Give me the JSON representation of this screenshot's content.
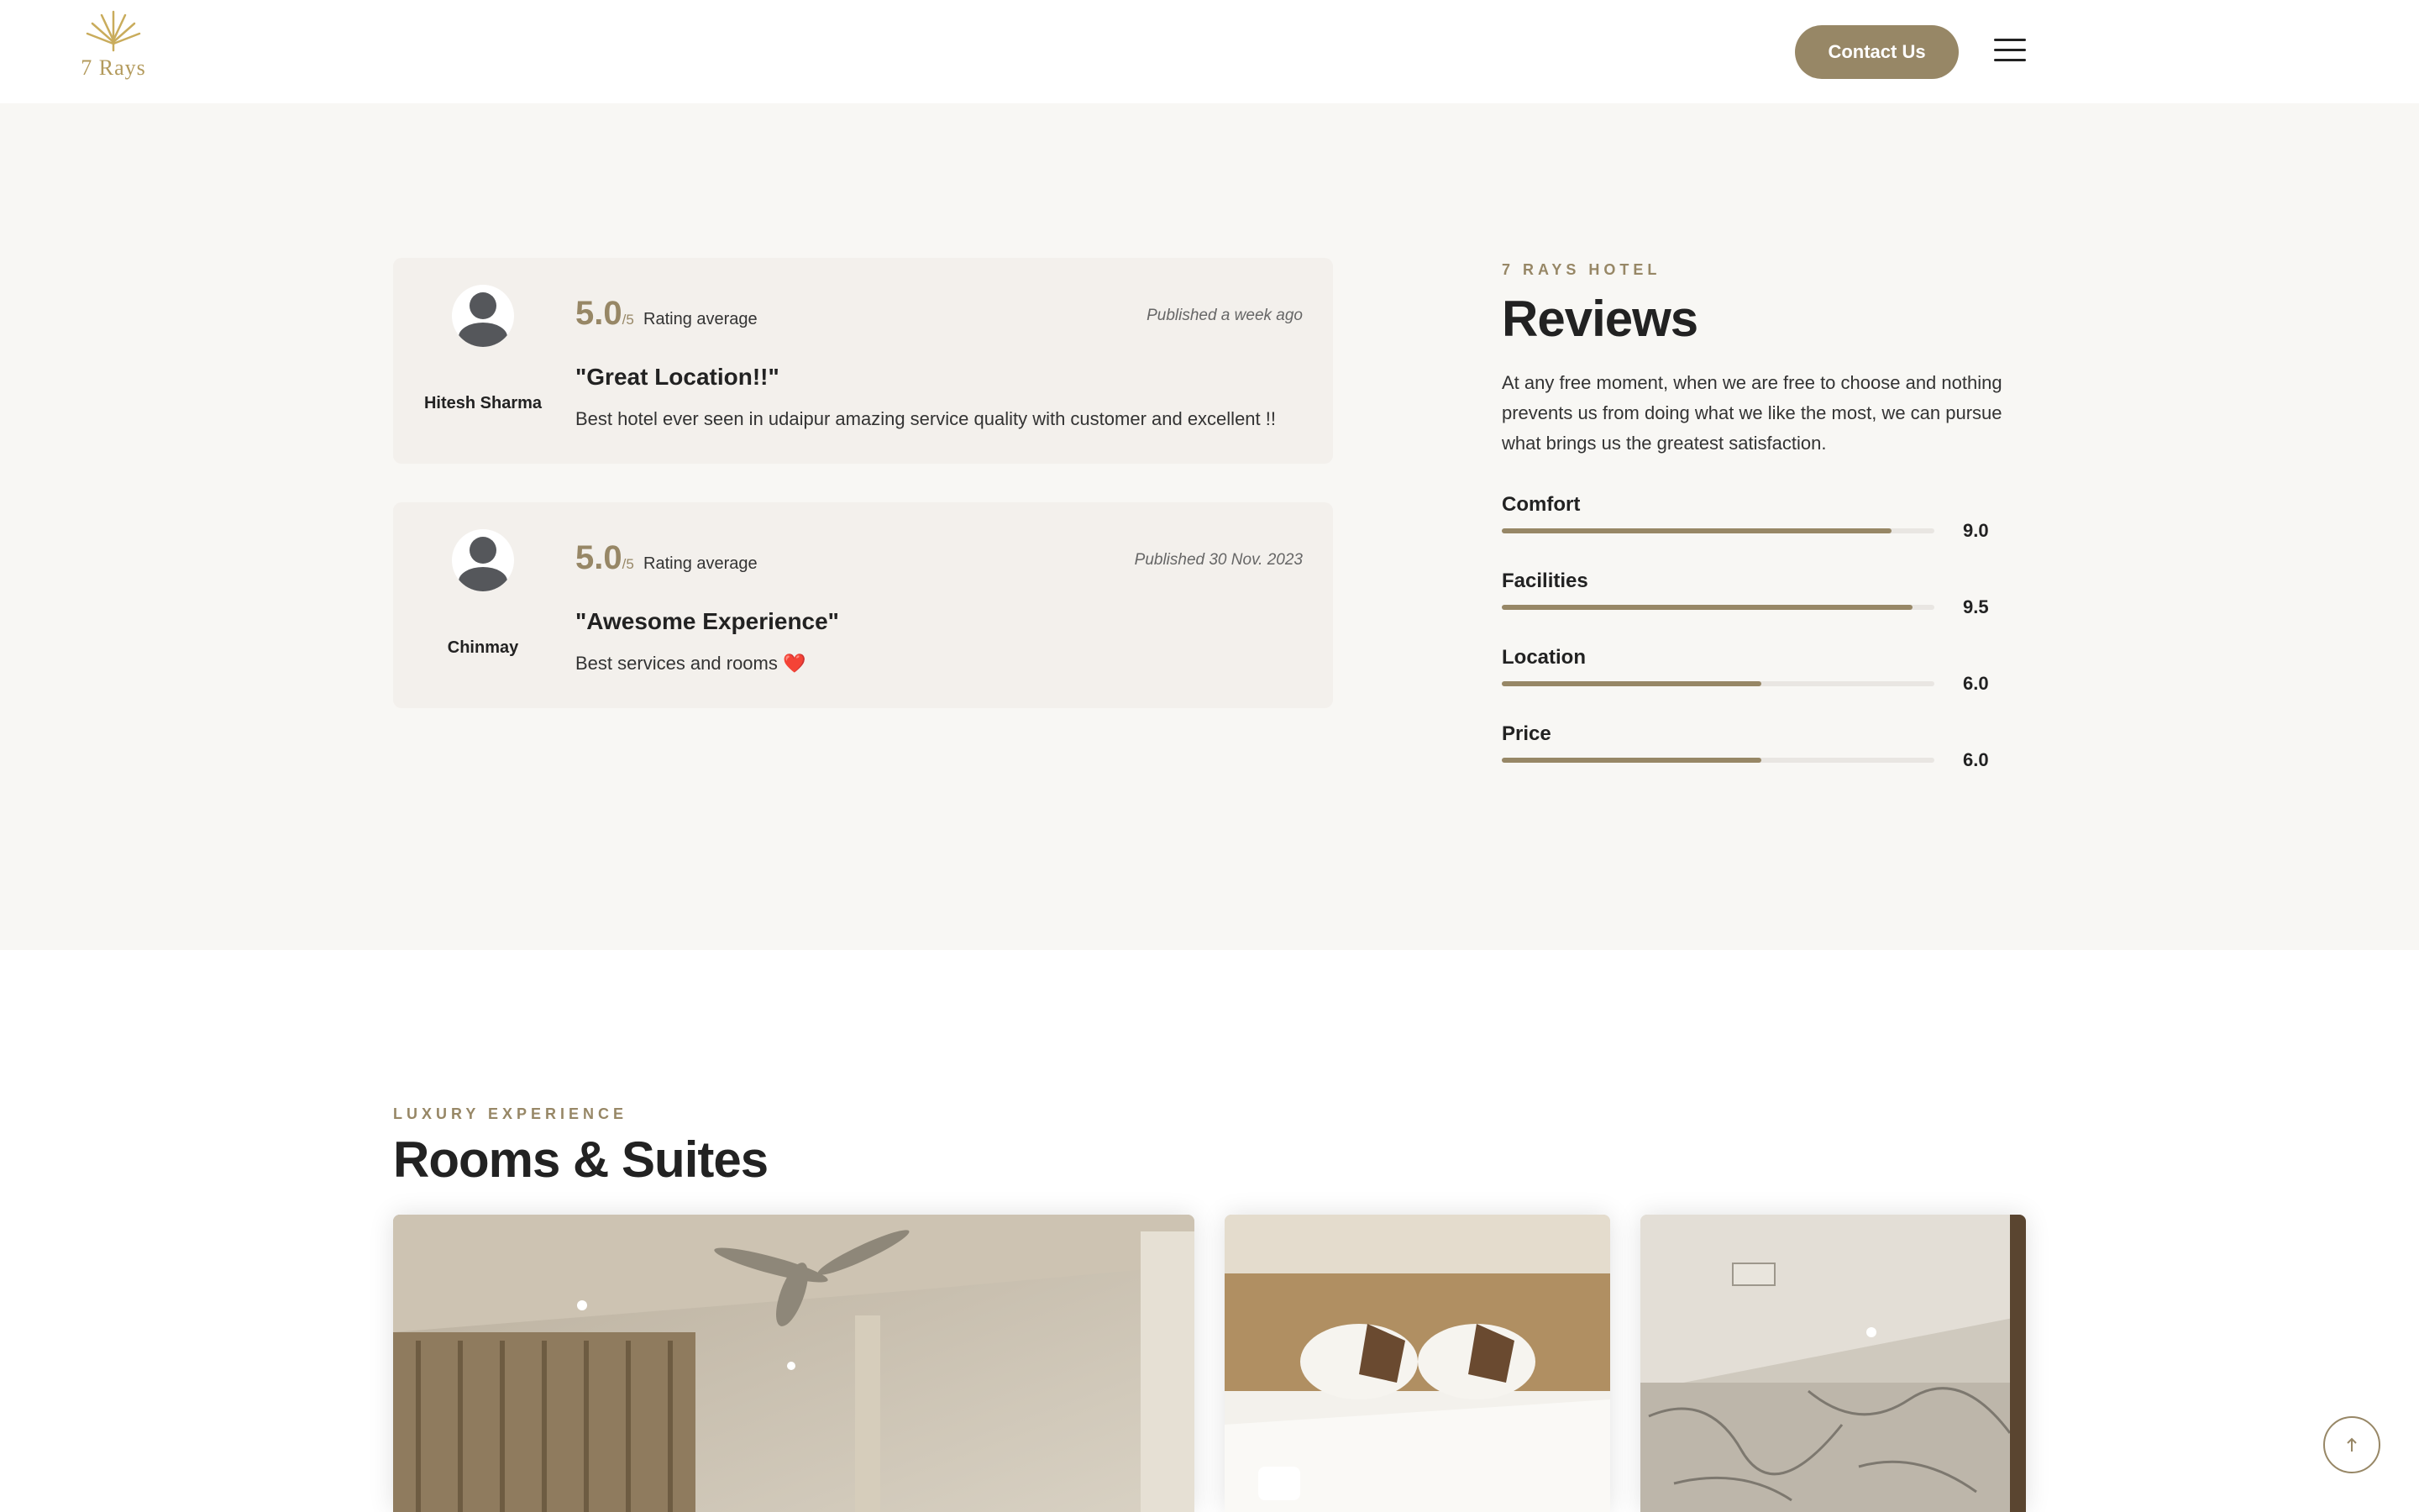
{
  "header": {
    "logo_text": "7 Rays",
    "contact_label": "Contact Us"
  },
  "reviews": [
    {
      "name": "Hitesh Sharma",
      "rating": "5.0",
      "rating_max": "/5",
      "rating_label": "Rating average",
      "published": "Published a week ago",
      "title": "\"Great Location!!\"",
      "body": "Best hotel ever seen in udaipur amazing service quality with customer and excellent !!"
    },
    {
      "name": "Chinmay",
      "rating": "5.0",
      "rating_max": "/5",
      "rating_label": "Rating average",
      "published": "Published 30 Nov. 2023",
      "title": "\"Awesome Experience\"",
      "body": "Best services and rooms ❤️"
    }
  ],
  "summary": {
    "kicker": "7 RAYS HOTEL",
    "heading": "Reviews",
    "description": "At any free moment, when we are free to choose and nothing prevents us from doing what we like the most, we can pursue what brings us the greatest satisfaction.",
    "scores": [
      {
        "label": "Comfort",
        "value": "9.0",
        "fraction": 0.9
      },
      {
        "label": "Facilities",
        "value": "9.5",
        "fraction": 0.95
      },
      {
        "label": "Location",
        "value": "6.0",
        "fraction": 0.6
      },
      {
        "label": "Price",
        "value": "6.0",
        "fraction": 0.6
      }
    ]
  },
  "rooms": {
    "kicker": "LUXURY EXPERIENCE",
    "heading": "Rooms & Suites"
  },
  "colors": {
    "accent": "#978766",
    "section_bg": "#f8f7f4",
    "card_bg": "#f3f0ec"
  },
  "icons": {
    "menu": "hamburger-icon",
    "scroll_top": "arrow-up-icon",
    "avatar": "user-icon"
  }
}
